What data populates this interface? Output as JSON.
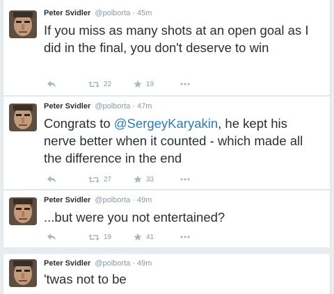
{
  "tweets": [
    {
      "author": "Peter Svidler",
      "handle": "@polborta",
      "time": "45m",
      "text_parts": [
        "If you miss as many shots at an open goal as I did in the final, you don't deserve to win"
      ],
      "retweets": "22",
      "favorites": "19"
    },
    {
      "author": "Peter Svidler",
      "handle": "@polborta",
      "time": "47m",
      "text_parts": [
        "Congrats to ",
        "@SergeyKaryakin",
        ", he kept his nerve better when it counted - which made all the difference in the end"
      ],
      "retweets": "27",
      "favorites": "33"
    },
    {
      "author": "Peter Svidler",
      "handle": "@polborta",
      "time": "49m",
      "text_parts": [
        "...but were you not entertained?"
      ],
      "retweets": "19",
      "favorites": "41"
    },
    {
      "author": "Peter Svidler",
      "handle": "@polborta",
      "time": "49m",
      "text_parts": [
        "'twas not to be"
      ]
    }
  ],
  "time_separator": "·",
  "icons": {
    "reply": "reply-icon",
    "retweet": "retweet-icon",
    "favorite": "star-icon",
    "more": "more-icon"
  },
  "colors": {
    "background": "#e6ecf0",
    "text": "#292f33",
    "muted": "#8899a6",
    "link": "#2b7bb9",
    "icon": "#aab8c2"
  }
}
